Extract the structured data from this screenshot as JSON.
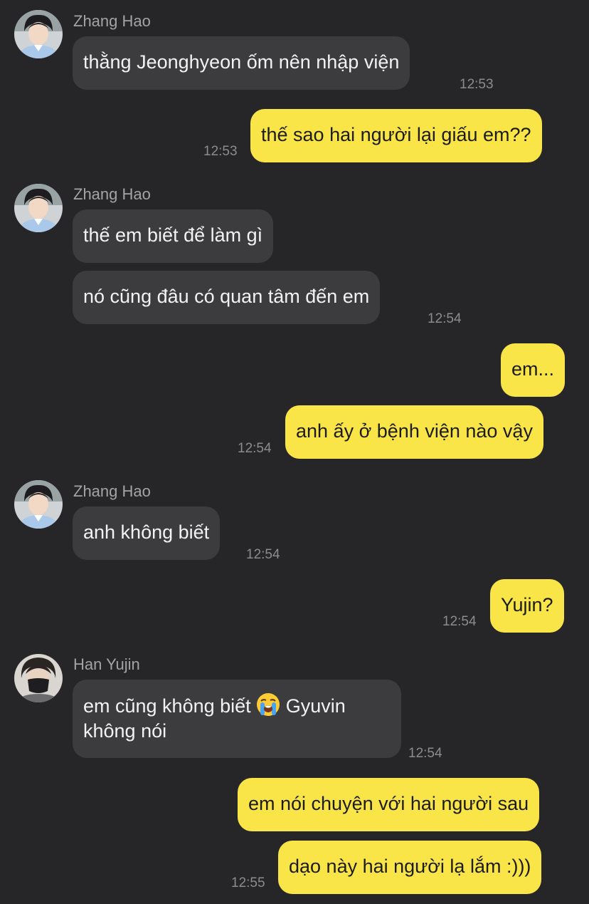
{
  "chat": {
    "messages": [
      {
        "sender": "Zhang Hao",
        "text": "thằng Jeonghyeon ốm nên nhập viện",
        "time": "12:53"
      },
      {
        "sender": "me",
        "text": "thế sao hai người lại giấu em??",
        "time": "12:53"
      },
      {
        "sender": "Zhang Hao",
        "text": "thế em biết để làm gì"
      },
      {
        "sender": "Zhang Hao",
        "text": "nó cũng đâu có quan tâm đến em",
        "time": "12:54"
      },
      {
        "sender": "me",
        "text": "em..."
      },
      {
        "sender": "me",
        "text": "anh ấy ở bệnh viện nào vậy",
        "time": "12:54"
      },
      {
        "sender": "Zhang Hao",
        "text": "anh không biết",
        "time": "12:54"
      },
      {
        "sender": "me",
        "text": "Yujin?",
        "time": "12:54"
      },
      {
        "sender": "Han Yujin",
        "text_before_emoji": "em cũng không biết",
        "emoji": "loudly-crying-face",
        "text_after_emoji": "Gyuvin",
        "text_line2": "không nói",
        "time": "12:54"
      },
      {
        "sender": "me",
        "text": "em nói chuyện với hai người sau"
      },
      {
        "sender": "me",
        "text": "dạo này hai người lạ lắm :)))",
        "time": "12:55"
      }
    ]
  },
  "colors": {
    "background": "#262628",
    "incoming_bubble": "#3c3c3f",
    "outgoing_bubble": "#f9e548",
    "sender_name": "#a3a3a6",
    "timestamp": "#8c8c8f"
  }
}
